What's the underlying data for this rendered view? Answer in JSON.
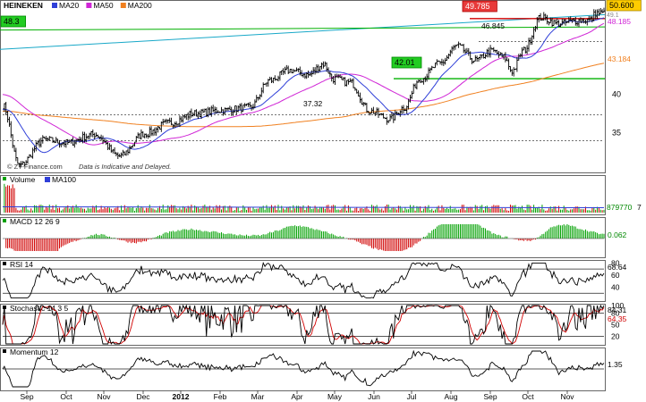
{
  "header": {
    "symbol": "HEINEKEN",
    "legend": [
      {
        "name": "MA20",
        "color": "#2f3fd8"
      },
      {
        "name": "MA50",
        "color": "#d026d6"
      },
      {
        "name": "MA200",
        "color": "#f08020"
      }
    ],
    "credit": "© ZT-Finance.com",
    "disclaimer": "Data is Indicative and Delayed."
  },
  "colors": {
    "price": "#000000",
    "ma20": "#2f3fd8",
    "ma50": "#d026d6",
    "ma200": "#f08020",
    "trendline": "#18a8c8",
    "support": "#00b000",
    "resistance": "#d00000",
    "up": "#00a000",
    "down": "#d00000",
    "signal": "#d00000"
  },
  "chart_data": [
    {
      "type": "line",
      "title": "HEINEKEN",
      "series_names": [
        "Price",
        "MA20",
        "MA50",
        "MA200"
      ],
      "ylim": [
        30,
        50.8
      ],
      "yticks": [
        35,
        40
      ],
      "x_ticks": [
        "Sep",
        "Oct",
        "Nov",
        "Dec",
        "2012",
        "Feb",
        "Mar",
        "Apr",
        "May",
        "Jun",
        "Jul",
        "Aug",
        "Sep",
        "Oct",
        "Nov"
      ],
      "price_anchors": [
        [
          0,
          38.6
        ],
        [
          10,
          30.8
        ],
        [
          25,
          34.1
        ],
        [
          38,
          33.7
        ],
        [
          55,
          34.8
        ],
        [
          70,
          32.0
        ],
        [
          85,
          34.9
        ],
        [
          100,
          36.3
        ],
        [
          115,
          37.5
        ],
        [
          130,
          37.9
        ],
        [
          148,
          38.3
        ],
        [
          160,
          41.8
        ],
        [
          172,
          43.1
        ],
        [
          183,
          42.5
        ],
        [
          192,
          43.9
        ],
        [
          198,
          42.0
        ],
        [
          208,
          41.5
        ],
        [
          220,
          37.8
        ],
        [
          232,
          36.8
        ],
        [
          240,
          38.2
        ],
        [
          250,
          42.0
        ],
        [
          262,
          44.0
        ],
        [
          272,
          46.2
        ],
        [
          283,
          44.4
        ],
        [
          293,
          45.6
        ],
        [
          300,
          44.8
        ],
        [
          305,
          43.0
        ],
        [
          312,
          45.7
        ],
        [
          322,
          49.9
        ],
        [
          333,
          49.1
        ],
        [
          343,
          49.5
        ],
        [
          352,
          49.6
        ],
        [
          355,
          50.5
        ]
      ],
      "ma_start": {
        "ma20": 38.0,
        "ma50": 40.0,
        "ma200": 37.8
      },
      "annotations": [
        {
          "label": "49.785",
          "value": 49.785,
          "style": "resistance"
        },
        {
          "label": "46.845",
          "value": 46.8,
          "style": "dashed"
        },
        {
          "label": "42.01",
          "value": 42.01,
          "style": "support"
        },
        {
          "label": "37.32",
          "value": 37.32,
          "style": "dashed"
        },
        {
          "label": "48.3",
          "style": "support-left"
        }
      ],
      "trendline": {
        "from": 45.8,
        "to": 50.3
      },
      "support_line": {
        "from": 48.3,
        "to": 48.7
      },
      "hlines": [
        37.32,
        34.0
      ],
      "last_values": [
        {
          "label": "50.600",
          "key": "price",
          "value": 50.6
        },
        {
          "label": "48.185",
          "key": "ma50",
          "value": 48.2
        },
        {
          "label": "43.184",
          "key": "ma200",
          "value": 43.18
        }
      ],
      "hidden_badge": "49.1"
    },
    {
      "type": "bar",
      "title": "Volume",
      "series_names": [
        "Volume",
        "MA100"
      ],
      "last_value": "879770",
      "last_value_suffix": "7"
    },
    {
      "type": "bar",
      "title": "MACD 12 26 9",
      "last_value": "0.062"
    },
    {
      "type": "line",
      "title": "RSI 14",
      "ylim": [
        20,
        82
      ],
      "yticks": [
        40,
        60,
        80
      ],
      "hlines": [
        30,
        70
      ],
      "last_value": "68.64"
    },
    {
      "type": "line",
      "title": "Stochastic 14 3 5",
      "ylim": [
        0,
        100
      ],
      "yticks": [
        20,
        50,
        80,
        100
      ],
      "hlines": [
        20,
        80
      ],
      "last_values": [
        "84.31",
        "64.35"
      ]
    },
    {
      "type": "line",
      "title": "Momentum 12",
      "last_value": "1.35"
    }
  ]
}
